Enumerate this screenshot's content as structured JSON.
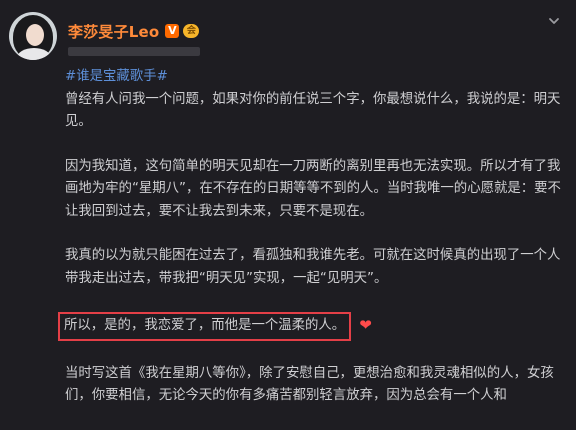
{
  "author": {
    "name": "李莎旻子Leo",
    "verified_badge": "V",
    "vip_badge": "会"
  },
  "post": {
    "hashtag": "#谁是宝藏歌手#",
    "paragraphs": [
      "曾经有人问我一个问题，如果对你的前任说三个字，你最想说什么，我说的是：明天见。",
      "因为我知道，这句简单的明天见却在一刀两断的离别里再也无法实现。所以才有了我画地为牢的“星期八”，在不存在的日期等等不到的人。当时我唯一的心愿就是：要不让我回到过去，要不让我去到未来，只要不是现在。",
      "我真的以为就只能困在过去了，看孤独和我谁先老。可就在这时候真的出现了一个人带我走出过去，带我把“明天见”实现，一起“见明天”。"
    ],
    "highlighted_text": "所以，是的，我恋爱了，而他是一个温柔的人。",
    "heart_emoji": "❤",
    "tail_paragraph": "当时写这首《我在星期八等你》，除了安慰自己，更想治愈和我灵魂相似的人，女孩们，你要相信，无论今天的你有多痛苦都别轻言放弃，因为总会有一个人和"
  },
  "icons": {
    "avatar": "avatar",
    "menu": "chevron-down-icon"
  },
  "colors": {
    "background": "#1e1d22",
    "username": "#ff8a3a",
    "hashtag": "#5d8fd8",
    "highlight_border": "#e43f47",
    "heart": "#ff4b4b"
  }
}
